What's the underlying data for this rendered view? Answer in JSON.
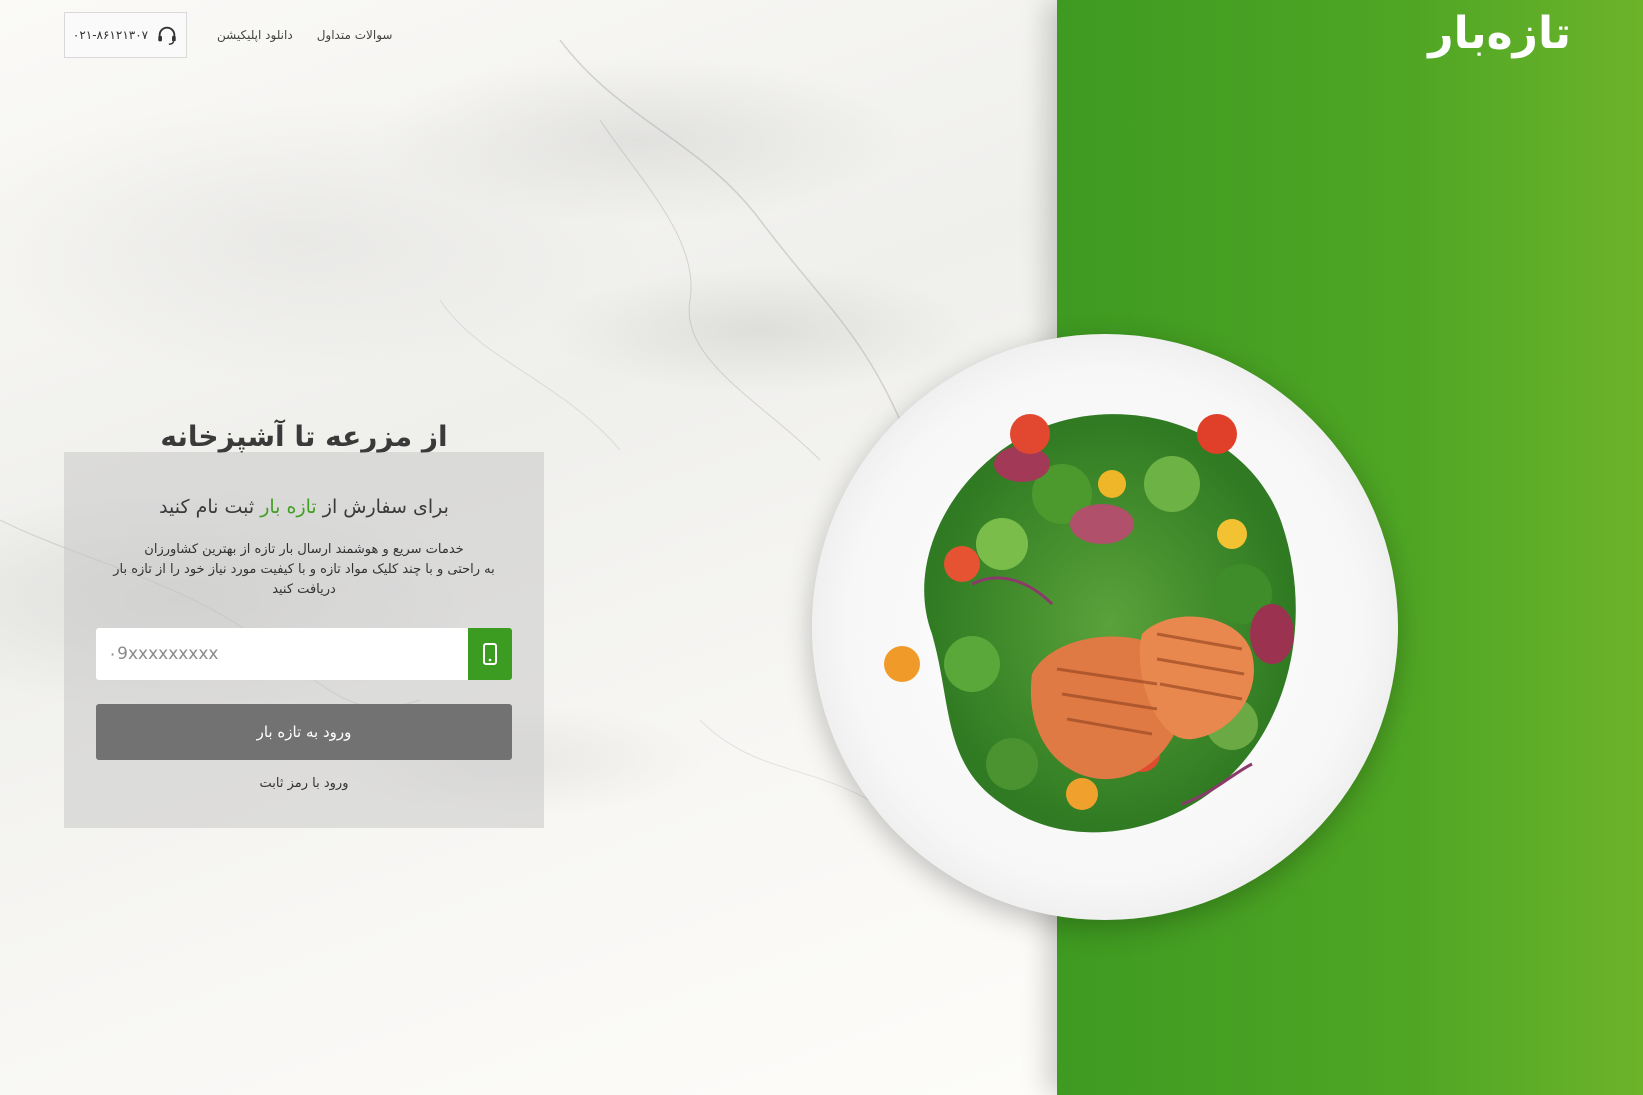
{
  "logo": {
    "text": "تازه‌بار"
  },
  "header": {
    "phone": "۰۲۱-۸۶۱۲۱۳۰۷",
    "nav": [
      "دانلود اپلیکیشن",
      "سوالات متداول"
    ]
  },
  "hero": {
    "title": "از مزرعه تا آشپزخانه"
  },
  "signup": {
    "heading_before": "برای سفارش از",
    "heading_brand": "تازه بار",
    "heading_after": "ثبت نام کنید",
    "desc_line1": "خدمات سریع و هوشمند ارسال بار تازه از بهترین کشاورزان",
    "desc_line2": "به راحتی و با چند کلیک مواد تازه و با کیفیت مورد نیاز خود را از تازه بار دریافت کنید",
    "phone_placeholder": "۰9xxxxxxxxx",
    "login_button": "ورود به تازه بار",
    "static_password_link": "ورود با رمز ثابت"
  },
  "colors": {
    "brand_green": "#41a021",
    "button_gray": "#727272"
  },
  "icons": [
    "headset-icon",
    "mobile-phone-icon"
  ]
}
